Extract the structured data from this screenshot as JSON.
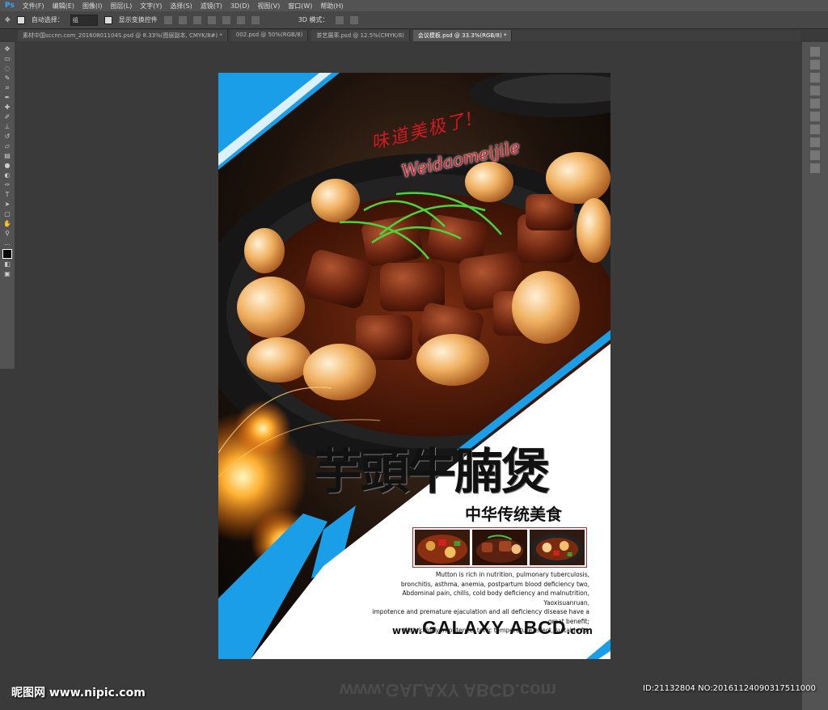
{
  "menubar": {
    "logo": "Ps",
    "items": [
      "文件(F)",
      "编辑(E)",
      "图像(I)",
      "图层(L)",
      "文字(Y)",
      "选择(S)",
      "滤镜(T)",
      "3D(D)",
      "视图(V)",
      "窗口(W)",
      "帮助(H)"
    ]
  },
  "options": {
    "auto_select_label": "自动选择：",
    "auto_select_value": "组",
    "show_transform_label": "显示变换控件",
    "mode_3d_label": "3D 模式："
  },
  "tabs": [
    {
      "label": "素材中国sccnn.com_20160801104S.psd @ 8.33%(图层副本, CMYK/8#) *",
      "active": false
    },
    {
      "label": "002.psd @ 50%(RGB/8)",
      "active": false
    },
    {
      "label": "茶艺展率.psd @ 12.5%(CMYK/8)",
      "active": false
    },
    {
      "label": "会议模板.psd @ 33.3%(RGB/8) *",
      "active": true
    }
  ],
  "poster": {
    "handwriting_cn": "味道美极了!",
    "handwriting_en": "Weidaomeijile",
    "title_cn": "芋頭牛腩煲",
    "subtitle_cn": "中华传统美食",
    "description": [
      "Mutton is rich in nutrition, pulmonary tuberculosis,",
      "bronchitis, asthma, anemia, postpartum blood deficiency two,",
      "Abdominal pain, chills, cold body deficiency and malnutrition, Yaoxisuanruan,",
      "impotence and premature ejaculation and all deficiency disease have a great benefit;",
      "With kidney impotence, tonic temperature effect, suitable for"
    ],
    "web_prefix": "www.",
    "web_main": "GALAXY ABCD",
    "web_suffix": ".com",
    "reflection_text": "www.GALAXY ABCD.com"
  },
  "watermark": {
    "left": "昵图网 www.nipic.com",
    "right": "ID:21132804 NO:20161124090317511000"
  },
  "colors": {
    "accent_blue": "#1a9ee8",
    "handwriting_red": "#d01a22",
    "ps_bg": "#3a3a3a"
  }
}
